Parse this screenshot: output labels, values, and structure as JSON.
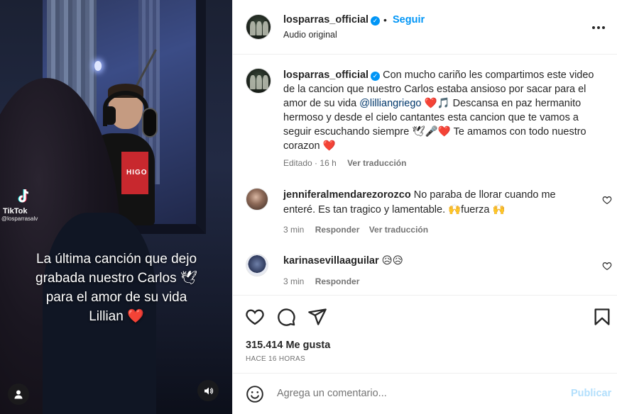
{
  "video": {
    "tiktok_brand": "TikTok",
    "tiktok_handle": "@losparrasalv",
    "shirt_text": "HIGO",
    "caption_lines": [
      "La última canción que dejo",
      "grabada nuestro Carlos 🕊",
      "para el amor de su vida",
      "Lillian"
    ],
    "caption_heart": "❤️"
  },
  "header": {
    "username": "losparras_official",
    "verified_mark": "✓",
    "separator": "•",
    "follow_label": "Seguir",
    "audio_label": "Audio original",
    "more_label": "•••"
  },
  "caption": {
    "username": "losparras_official",
    "text_before_mention": "Con mucho cariño les compartimos este video de la cancion que nuestro Carlos estaba ansioso por sacar para el amor de su vida",
    "mention": "@lilliangriego",
    "text_after_mention": "❤️🎵 Descansa en paz hermanito hermoso y desde el cielo cantantes esta cancion que te vamos a seguir escuchando siempre 🕊🎤❤️ Te amamos con todo nuestro corazon ❤️",
    "edited_label": "Editado",
    "time": "16 h",
    "translate_label": "Ver traducción"
  },
  "comments": [
    {
      "username": "jenniferalmendarezorozco",
      "text": "No paraba de llorar cuando me enteré. Es tan tragico y lamentable. 🙌fuerza 🙌",
      "time": "3 min",
      "reply_label": "Responder",
      "translate_label": "Ver traducción"
    },
    {
      "username": "karinasevillaaguilar",
      "text": "😥😥",
      "time": "3 min",
      "reply_label": "Responder"
    }
  ],
  "actions": {
    "likes": "315.414 Me gusta",
    "posted": "HACE 16 HORAS"
  },
  "composer": {
    "placeholder": "Agrega un comentario...",
    "post_label": "Publicar"
  },
  "colors": {
    "accent": "#0095f6",
    "heart": "#e0242d",
    "muted": "#737373",
    "post_disabled": "#b2dffc"
  }
}
